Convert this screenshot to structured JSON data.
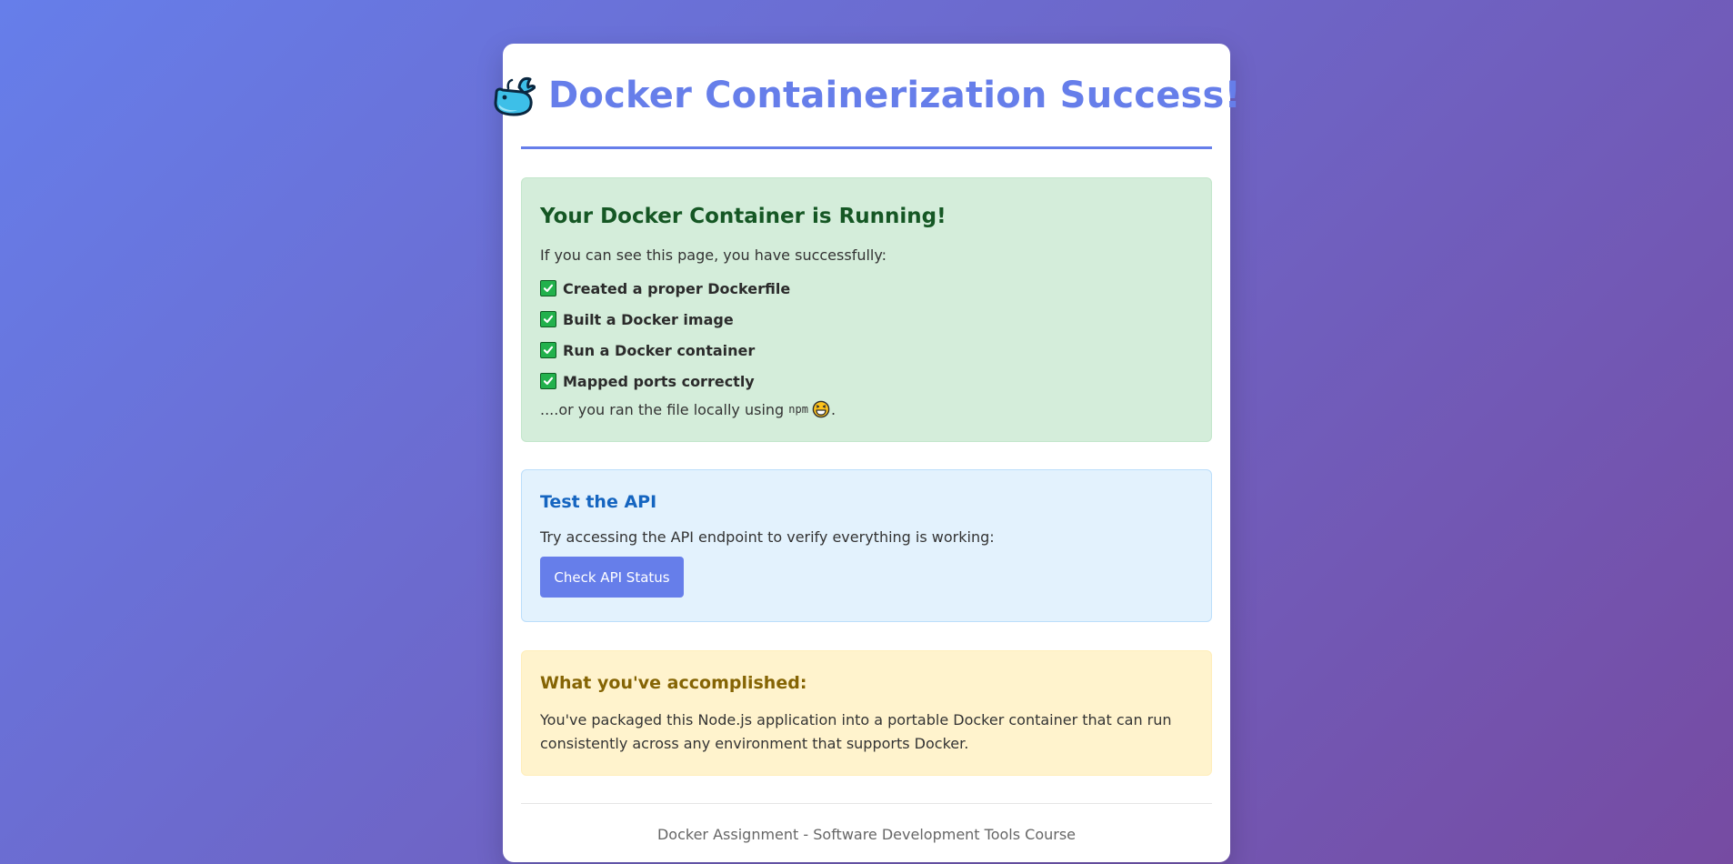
{
  "header": {
    "title": "Docker Containerization Success!",
    "icon": "whale-icon"
  },
  "success_box": {
    "heading": "Your Docker Container is Running!",
    "intro": "If you can see this page, you have successfully:",
    "items": [
      "Created a proper Dockerfile",
      "Built a Docker image",
      "Run a Docker container",
      "Mapped ports correctly"
    ],
    "outro_prefix": "....or you ran the file locally using ",
    "outro_code": "npm",
    "outro_suffix": ".",
    "icon_check": "check-mark-button-icon",
    "icon_laugh": "laughing-face-icon"
  },
  "api_box": {
    "heading": "Test the API",
    "text": "Try accessing the API endpoint to verify everything is working:",
    "button_label": "Check API Status"
  },
  "accomplished_box": {
    "heading": "What you've accomplished:",
    "text": "You've packaged this Node.js application into a portable Docker container that can run consistently across any environment that supports Docker."
  },
  "footer": {
    "text": "Docker Assignment - Software Development Tools Course"
  },
  "colors": {
    "accent": "#667eea",
    "background_start": "#667eea",
    "background_end": "#764ba2",
    "success_bg": "#d4edda",
    "success_heading": "#155724",
    "info_bg": "#e3f2fd",
    "info_heading": "#1565c0",
    "warning_bg": "#fff3cd",
    "warning_heading": "#856404"
  }
}
